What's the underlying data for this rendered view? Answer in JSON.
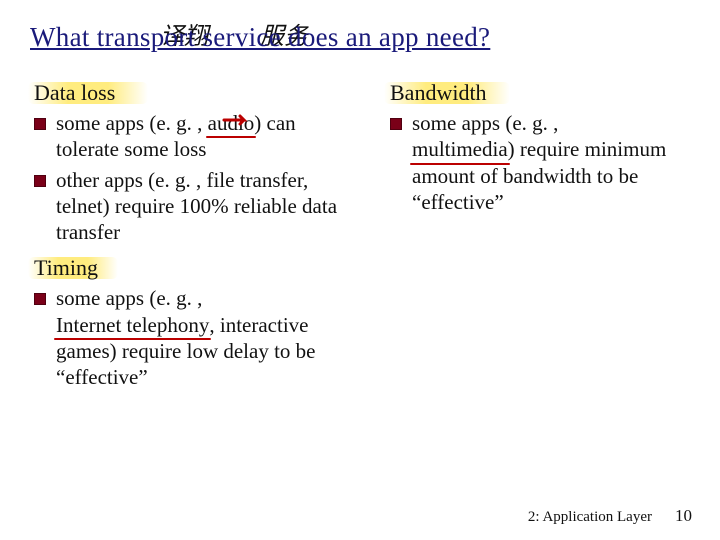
{
  "title": "What transport service does an app need?",
  "chinese": {
    "over_transport": "译翔",
    "over_service": "服务"
  },
  "left": {
    "heading1": "Data loss",
    "bullet1": "tolerate some loss",
    "bullet1_prefix": "some apps (e. g. , ",
    "bullet1_audio": "audio",
    "bullet1_after_audio": ") can",
    "bullet2": "other apps (e. g. , file transfer, telnet) require 100% reliable data transfer",
    "heading2": "Timing",
    "bullet3_prefix": "some apps (e. g. , ",
    "bullet3_tel": "Internet telephony",
    "bullet3_after": ", interactive games) require low delay to be “effective”"
  },
  "right": {
    "heading": "Bandwidth",
    "bullet_prefix": "some apps (e. g. , ",
    "bullet_mm": "multimedia",
    "bullet_after": ") require minimum amount of bandwidth to be “effective”"
  },
  "footer": {
    "label": "2: Application Layer",
    "page": "10"
  }
}
